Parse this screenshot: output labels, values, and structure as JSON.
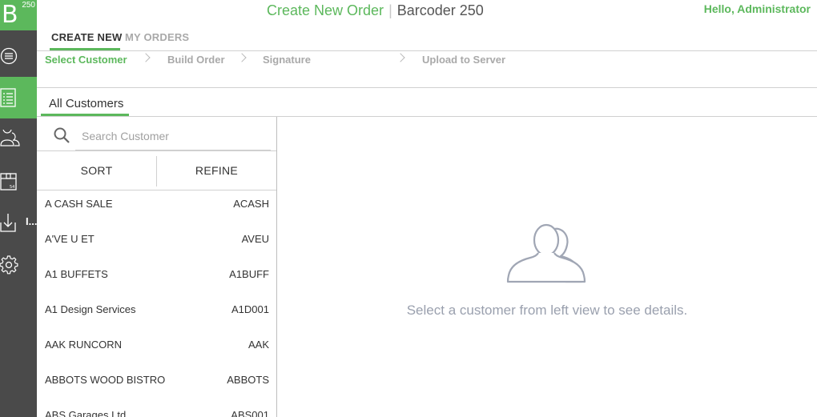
{
  "logo": {
    "letter": "B",
    "number": "250"
  },
  "header": {
    "title_primary": "Create New Order",
    "title_separator": "|",
    "title_secondary": "Barcoder 250",
    "greeting": "Hello, Administrator"
  },
  "sidebar": {
    "items": [
      {
        "icon": "menu-circle-icon",
        "active": false
      },
      {
        "icon": "order-list-icon",
        "active": true
      },
      {
        "icon": "customers-icon",
        "active": false
      },
      {
        "icon": "package-box-icon",
        "active": false
      },
      {
        "icon": "download-inbox-icon",
        "active": false,
        "badge": "I..."
      },
      {
        "icon": "settings-gear-icon",
        "active": false
      }
    ]
  },
  "top_tabs": [
    {
      "label": "CREATE NEW",
      "active": true
    },
    {
      "label": "MY ORDERS",
      "active": false
    }
  ],
  "steps": [
    {
      "label": "Select Customer",
      "active": true
    },
    {
      "label": "Build Order",
      "active": false
    },
    {
      "label": "Signature",
      "active": false
    },
    {
      "label": "Upload to Server",
      "active": false
    }
  ],
  "customers_tab": {
    "label": "All Customers"
  },
  "search": {
    "placeholder": "Search Customer",
    "value": ""
  },
  "sort_bar": {
    "sort_label": "SORT",
    "refine_label": "REFINE"
  },
  "customers": [
    {
      "name": "A CASH SALE",
      "code": "ACASH"
    },
    {
      "name": "A'VE U ET",
      "code": "AVEU"
    },
    {
      "name": "A1 BUFFETS",
      "code": "A1BUFF"
    },
    {
      "name": "A1 Design Services",
      "code": "A1D001"
    },
    {
      "name": "AAK RUNCORN",
      "code": "AAK"
    },
    {
      "name": "ABBOTS WOOD BISTRO",
      "code": "ABBOTS"
    },
    {
      "name": "ABS Garages Ltd",
      "code": "ABS001"
    }
  ],
  "empty_state": {
    "icon": "customers-group-icon",
    "message": "Select a customer from left view to see details."
  },
  "colors": {
    "accent_green": "#5cb85c",
    "sidebar_bg": "#4a4a4a",
    "muted_text": "#a9a9a9",
    "empty_state_color": "#9aa0ae"
  }
}
